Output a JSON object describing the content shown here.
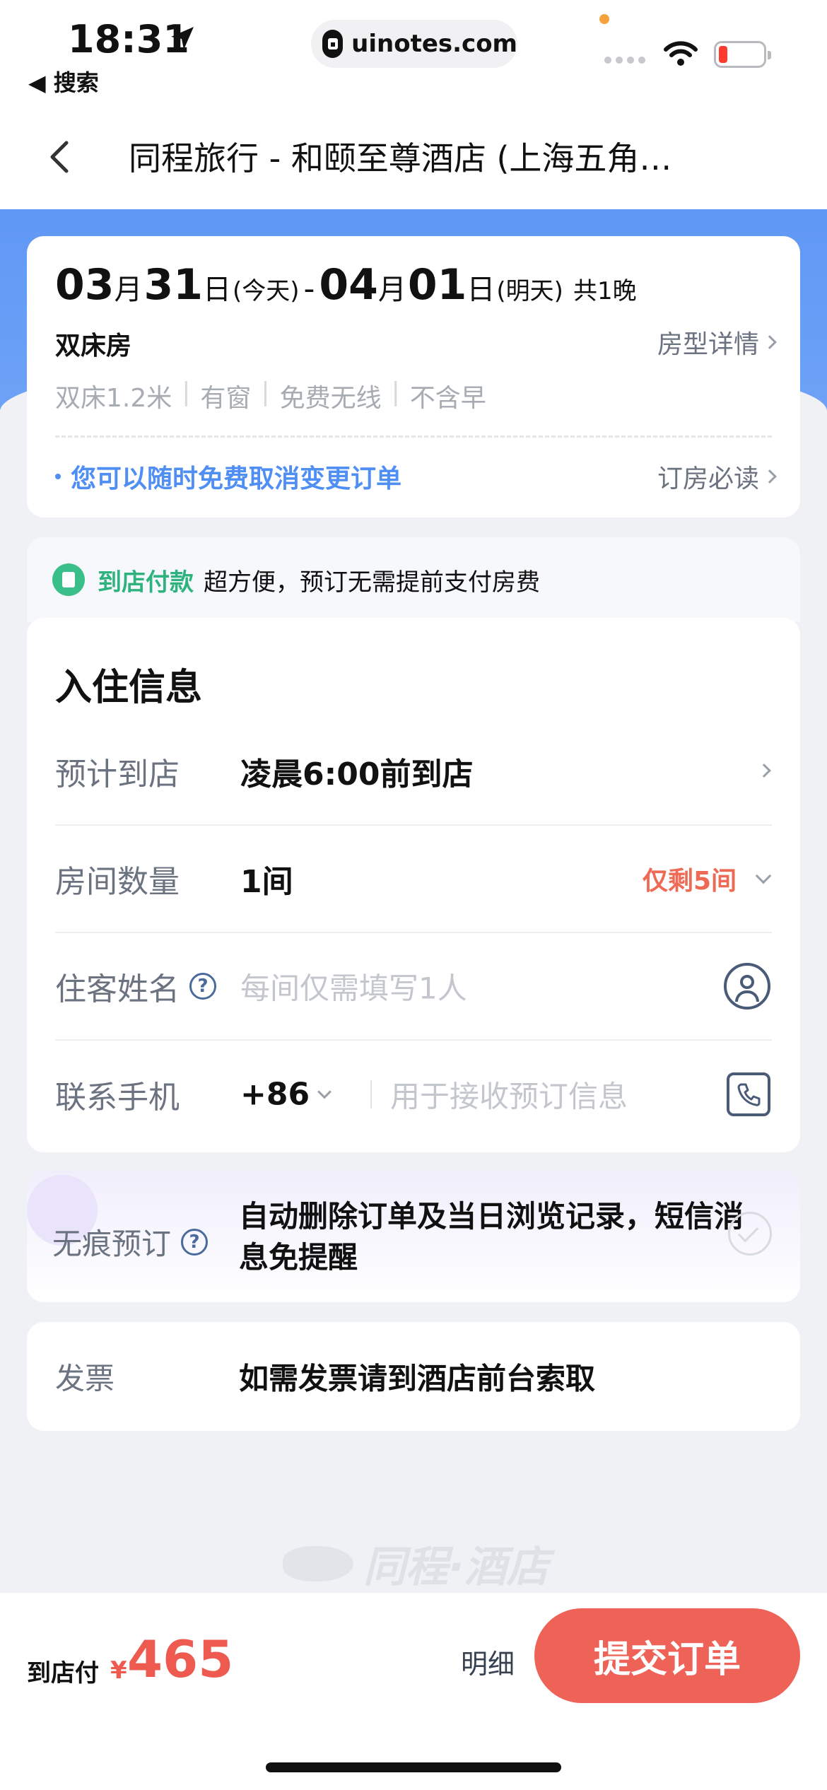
{
  "status_bar": {
    "time": "18:31",
    "back_app": "◀ 搜索",
    "url": "uinotes.com"
  },
  "nav": {
    "title": "同程旅行 - 和颐至尊酒店 (上海五角…"
  },
  "stay": {
    "checkin_month": "03",
    "checkin_day": "31",
    "checkin_tag": "(今天)",
    "checkout_month": "04",
    "checkout_day": "01",
    "checkout_tag": "(明天)",
    "month_unit": "月",
    "day_unit": "日",
    "dash": "-",
    "nights": "共1晚",
    "room_name": "双床房",
    "room_detail_link": "房型详情",
    "tags": [
      "双床1.2米",
      "有窗",
      "免费无线",
      "不含早"
    ],
    "cancel_note": "您可以随时免费取消变更订单",
    "must_read_link": "订房必读"
  },
  "payment_banner": {
    "highlight": "到店付款",
    "text": "超方便，预订无需提前支付房费"
  },
  "checkin_info": {
    "title": "入住信息",
    "arrival_label": "预计到店",
    "arrival_value": "凌晨6:00前到店",
    "rooms_label": "房间数量",
    "rooms_value": "1间",
    "rooms_left": "仅剩5间",
    "guest_label": "住客姓名",
    "guest_placeholder": "每间仅需填写1人",
    "phone_label": "联系手机",
    "country_code": "+86",
    "phone_placeholder": "用于接收预订信息",
    "help_mark": "?"
  },
  "private_booking": {
    "label": "无痕预订",
    "text": "自动删除订单及当日浏览记录，短信消息免提醒",
    "help_mark": "?"
  },
  "invoice": {
    "label": "发票",
    "value": "如需发票请到酒店前台索取"
  },
  "watermark": {
    "text": "同程·酒店"
  },
  "bottom_bar": {
    "pay_at_hotel": "到店付",
    "currency": "¥",
    "price": "465",
    "detail_link": "明细",
    "submit_label": "提交订单"
  },
  "colors": {
    "brand_blue": "#5f98f5",
    "accent_red": "#ee6258",
    "green": "#2fb37e"
  }
}
